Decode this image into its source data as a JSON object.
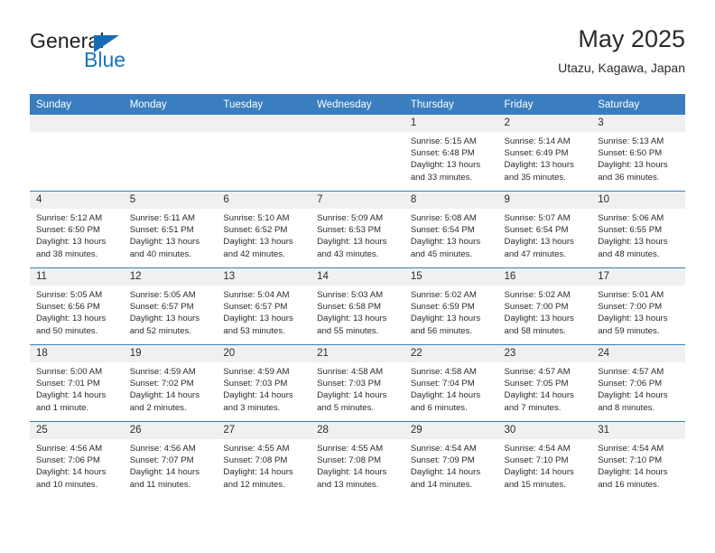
{
  "brand": {
    "name_part1": "General",
    "name_part2": "Blue",
    "triangle_color": "#156cb4",
    "blue_color": "#1b75bb"
  },
  "header": {
    "month_title": "May 2025",
    "location": "Utazu, Kagawa, Japan"
  },
  "theme": {
    "header_bg": "#3a7ebf",
    "daynum_bg": "#f0f0f0",
    "row_rule": "#3a7ebf",
    "text": "#2b2b2b"
  },
  "weekdays": [
    "Sunday",
    "Monday",
    "Tuesday",
    "Wednesday",
    "Thursday",
    "Friday",
    "Saturday"
  ],
  "weeks": [
    [
      {
        "day": "",
        "sunrise": "",
        "sunset": "",
        "daylight1": "",
        "daylight2": ""
      },
      {
        "day": "",
        "sunrise": "",
        "sunset": "",
        "daylight1": "",
        "daylight2": ""
      },
      {
        "day": "",
        "sunrise": "",
        "sunset": "",
        "daylight1": "",
        "daylight2": ""
      },
      {
        "day": "",
        "sunrise": "",
        "sunset": "",
        "daylight1": "",
        "daylight2": ""
      },
      {
        "day": "1",
        "sunrise": "Sunrise: 5:15 AM",
        "sunset": "Sunset: 6:48 PM",
        "daylight1": "Daylight: 13 hours",
        "daylight2": "and 33 minutes."
      },
      {
        "day": "2",
        "sunrise": "Sunrise: 5:14 AM",
        "sunset": "Sunset: 6:49 PM",
        "daylight1": "Daylight: 13 hours",
        "daylight2": "and 35 minutes."
      },
      {
        "day": "3",
        "sunrise": "Sunrise: 5:13 AM",
        "sunset": "Sunset: 6:50 PM",
        "daylight1": "Daylight: 13 hours",
        "daylight2": "and 36 minutes."
      }
    ],
    [
      {
        "day": "4",
        "sunrise": "Sunrise: 5:12 AM",
        "sunset": "Sunset: 6:50 PM",
        "daylight1": "Daylight: 13 hours",
        "daylight2": "and 38 minutes."
      },
      {
        "day": "5",
        "sunrise": "Sunrise: 5:11 AM",
        "sunset": "Sunset: 6:51 PM",
        "daylight1": "Daylight: 13 hours",
        "daylight2": "and 40 minutes."
      },
      {
        "day": "6",
        "sunrise": "Sunrise: 5:10 AM",
        "sunset": "Sunset: 6:52 PM",
        "daylight1": "Daylight: 13 hours",
        "daylight2": "and 42 minutes."
      },
      {
        "day": "7",
        "sunrise": "Sunrise: 5:09 AM",
        "sunset": "Sunset: 6:53 PM",
        "daylight1": "Daylight: 13 hours",
        "daylight2": "and 43 minutes."
      },
      {
        "day": "8",
        "sunrise": "Sunrise: 5:08 AM",
        "sunset": "Sunset: 6:54 PM",
        "daylight1": "Daylight: 13 hours",
        "daylight2": "and 45 minutes."
      },
      {
        "day": "9",
        "sunrise": "Sunrise: 5:07 AM",
        "sunset": "Sunset: 6:54 PM",
        "daylight1": "Daylight: 13 hours",
        "daylight2": "and 47 minutes."
      },
      {
        "day": "10",
        "sunrise": "Sunrise: 5:06 AM",
        "sunset": "Sunset: 6:55 PM",
        "daylight1": "Daylight: 13 hours",
        "daylight2": "and 48 minutes."
      }
    ],
    [
      {
        "day": "11",
        "sunrise": "Sunrise: 5:05 AM",
        "sunset": "Sunset: 6:56 PM",
        "daylight1": "Daylight: 13 hours",
        "daylight2": "and 50 minutes."
      },
      {
        "day": "12",
        "sunrise": "Sunrise: 5:05 AM",
        "sunset": "Sunset: 6:57 PM",
        "daylight1": "Daylight: 13 hours",
        "daylight2": "and 52 minutes."
      },
      {
        "day": "13",
        "sunrise": "Sunrise: 5:04 AM",
        "sunset": "Sunset: 6:57 PM",
        "daylight1": "Daylight: 13 hours",
        "daylight2": "and 53 minutes."
      },
      {
        "day": "14",
        "sunrise": "Sunrise: 5:03 AM",
        "sunset": "Sunset: 6:58 PM",
        "daylight1": "Daylight: 13 hours",
        "daylight2": "and 55 minutes."
      },
      {
        "day": "15",
        "sunrise": "Sunrise: 5:02 AM",
        "sunset": "Sunset: 6:59 PM",
        "daylight1": "Daylight: 13 hours",
        "daylight2": "and 56 minutes."
      },
      {
        "day": "16",
        "sunrise": "Sunrise: 5:02 AM",
        "sunset": "Sunset: 7:00 PM",
        "daylight1": "Daylight: 13 hours",
        "daylight2": "and 58 minutes."
      },
      {
        "day": "17",
        "sunrise": "Sunrise: 5:01 AM",
        "sunset": "Sunset: 7:00 PM",
        "daylight1": "Daylight: 13 hours",
        "daylight2": "and 59 minutes."
      }
    ],
    [
      {
        "day": "18",
        "sunrise": "Sunrise: 5:00 AM",
        "sunset": "Sunset: 7:01 PM",
        "daylight1": "Daylight: 14 hours",
        "daylight2": "and 1 minute."
      },
      {
        "day": "19",
        "sunrise": "Sunrise: 4:59 AM",
        "sunset": "Sunset: 7:02 PM",
        "daylight1": "Daylight: 14 hours",
        "daylight2": "and 2 minutes."
      },
      {
        "day": "20",
        "sunrise": "Sunrise: 4:59 AM",
        "sunset": "Sunset: 7:03 PM",
        "daylight1": "Daylight: 14 hours",
        "daylight2": "and 3 minutes."
      },
      {
        "day": "21",
        "sunrise": "Sunrise: 4:58 AM",
        "sunset": "Sunset: 7:03 PM",
        "daylight1": "Daylight: 14 hours",
        "daylight2": "and 5 minutes."
      },
      {
        "day": "22",
        "sunrise": "Sunrise: 4:58 AM",
        "sunset": "Sunset: 7:04 PM",
        "daylight1": "Daylight: 14 hours",
        "daylight2": "and 6 minutes."
      },
      {
        "day": "23",
        "sunrise": "Sunrise: 4:57 AM",
        "sunset": "Sunset: 7:05 PM",
        "daylight1": "Daylight: 14 hours",
        "daylight2": "and 7 minutes."
      },
      {
        "day": "24",
        "sunrise": "Sunrise: 4:57 AM",
        "sunset": "Sunset: 7:06 PM",
        "daylight1": "Daylight: 14 hours",
        "daylight2": "and 8 minutes."
      }
    ],
    [
      {
        "day": "25",
        "sunrise": "Sunrise: 4:56 AM",
        "sunset": "Sunset: 7:06 PM",
        "daylight1": "Daylight: 14 hours",
        "daylight2": "and 10 minutes."
      },
      {
        "day": "26",
        "sunrise": "Sunrise: 4:56 AM",
        "sunset": "Sunset: 7:07 PM",
        "daylight1": "Daylight: 14 hours",
        "daylight2": "and 11 minutes."
      },
      {
        "day": "27",
        "sunrise": "Sunrise: 4:55 AM",
        "sunset": "Sunset: 7:08 PM",
        "daylight1": "Daylight: 14 hours",
        "daylight2": "and 12 minutes."
      },
      {
        "day": "28",
        "sunrise": "Sunrise: 4:55 AM",
        "sunset": "Sunset: 7:08 PM",
        "daylight1": "Daylight: 14 hours",
        "daylight2": "and 13 minutes."
      },
      {
        "day": "29",
        "sunrise": "Sunrise: 4:54 AM",
        "sunset": "Sunset: 7:09 PM",
        "daylight1": "Daylight: 14 hours",
        "daylight2": "and 14 minutes."
      },
      {
        "day": "30",
        "sunrise": "Sunrise: 4:54 AM",
        "sunset": "Sunset: 7:10 PM",
        "daylight1": "Daylight: 14 hours",
        "daylight2": "and 15 minutes."
      },
      {
        "day": "31",
        "sunrise": "Sunrise: 4:54 AM",
        "sunset": "Sunset: 7:10 PM",
        "daylight1": "Daylight: 14 hours",
        "daylight2": "and 16 minutes."
      }
    ]
  ]
}
